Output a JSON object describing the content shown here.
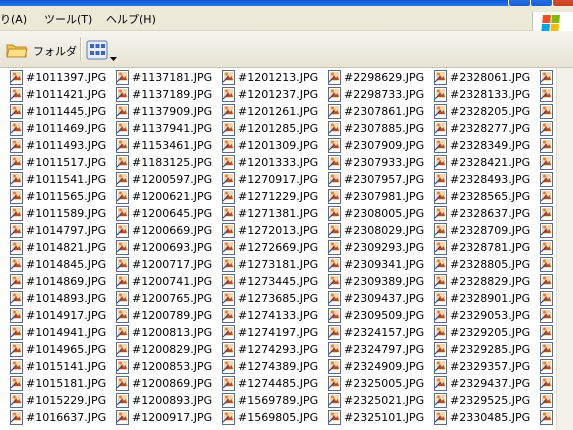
{
  "menu": {
    "items": [
      "り(A)",
      "ツール(T)",
      "ヘルプ(H)"
    ]
  },
  "toolbar": {
    "folder_label": "フォルダ"
  },
  "columns": [
    [
      "#1011397.JPG",
      "#1011421.JPG",
      "#1011445.JPG",
      "#1011469.JPG",
      "#1011493.JPG",
      "#1011517.JPG",
      "#1011541.JPG",
      "#1011565.JPG",
      "#1011589.JPG",
      "#1014797.JPG",
      "#1014821.JPG",
      "#1014845.JPG",
      "#1014869.JPG",
      "#1014893.JPG",
      "#1014917.JPG",
      "#1014941.JPG",
      "#1014965.JPG",
      "#1015141.JPG",
      "#1015181.JPG",
      "#1015229.JPG",
      "#1016637.JPG"
    ],
    [
      "#1137181.JPG",
      "#1137189.JPG",
      "#1137909.JPG",
      "#1137941.JPG",
      "#1153461.JPG",
      "#1183125.JPG",
      "#1200597.JPG",
      "#1200621.JPG",
      "#1200645.JPG",
      "#1200669.JPG",
      "#1200693.JPG",
      "#1200717.JPG",
      "#1200741.JPG",
      "#1200765.JPG",
      "#1200789.JPG",
      "#1200813.JPG",
      "#1200829.JPG",
      "#1200853.JPG",
      "#1200869.JPG",
      "#1200893.JPG",
      "#1200917.JPG"
    ],
    [
      "#1201213.JPG",
      "#1201237.JPG",
      "#1201261.JPG",
      "#1201285.JPG",
      "#1201309.JPG",
      "#1201333.JPG",
      "#1270917.JPG",
      "#1271229.JPG",
      "#1271381.JPG",
      "#1272013.JPG",
      "#1272669.JPG",
      "#1273181.JPG",
      "#1273445.JPG",
      "#1273685.JPG",
      "#1274133.JPG",
      "#1274197.JPG",
      "#1274293.JPG",
      "#1274389.JPG",
      "#1274485.JPG",
      "#1569789.JPG",
      "#1569805.JPG"
    ],
    [
      "#2298629.JPG",
      "#2298733.JPG",
      "#2307861.JPG",
      "#2307885.JPG",
      "#2307909.JPG",
      "#2307933.JPG",
      "#2307957.JPG",
      "#2307981.JPG",
      "#2308005.JPG",
      "#2308029.JPG",
      "#2309293.JPG",
      "#2309341.JPG",
      "#2309389.JPG",
      "#2309437.JPG",
      "#2309509.JPG",
      "#2324157.JPG",
      "#2324797.JPG",
      "#2324909.JPG",
      "#2325005.JPG",
      "#2325021.JPG",
      "#2325101.JPG"
    ],
    [
      "#2328061.JPG",
      "#2328133.JPG",
      "#2328205.JPG",
      "#2328277.JPG",
      "#2328349.JPG",
      "#2328421.JPG",
      "#2328493.JPG",
      "#2328565.JPG",
      "#2328637.JPG",
      "#2328709.JPG",
      "#2328781.JPG",
      "#2328805.JPG",
      "#2328829.JPG",
      "#2328901.JPG",
      "#2329053.JPG",
      "#2329205.JPG",
      "#2329285.JPG",
      "#2329357.JPG",
      "#2329437.JPG",
      "#2329525.JPG",
      "#2330485.JPG"
    ]
  ],
  "last_column_rows": 21
}
